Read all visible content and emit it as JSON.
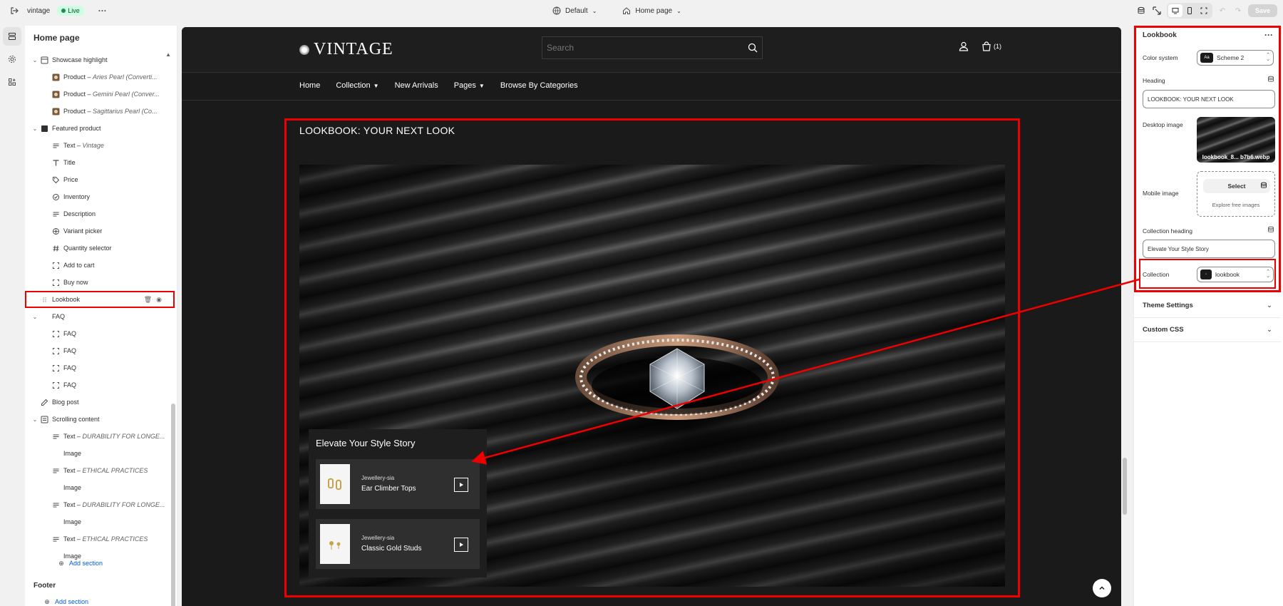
{
  "topbar": {
    "store_name": "vintage",
    "live_badge": "Live",
    "theme_select": "Default",
    "page_select": "Home page",
    "save_label": "Save"
  },
  "sidebar": {
    "title": "Home page",
    "items": [
      {
        "level": 0,
        "chev": "v",
        "icon": "grid-icon",
        "label": "Showcase highlight"
      },
      {
        "level": 1,
        "icon": "product-thumb",
        "label": "Product – ",
        "em": "Aries Pearl (Converti..."
      },
      {
        "level": 1,
        "icon": "product-thumb",
        "label": "Product – ",
        "em": "Gemini Pearl (Conver..."
      },
      {
        "level": 1,
        "icon": "product-thumb",
        "label": "Product – ",
        "em": "Sagittarius Pearl (Co..."
      },
      {
        "level": 0,
        "chev": "v",
        "icon": "featured-product-icon",
        "label": "Featured product"
      },
      {
        "level": 1,
        "icon": "text-lines-icon",
        "label": "Text – ",
        "em": "Vintage"
      },
      {
        "level": 1,
        "icon": "title-icon",
        "label": "Title"
      },
      {
        "level": 1,
        "icon": "price-tag-icon",
        "label": "Price"
      },
      {
        "level": 1,
        "icon": "inventory-icon",
        "label": "Inventory"
      },
      {
        "level": 1,
        "icon": "text-lines-icon",
        "label": "Description"
      },
      {
        "level": 1,
        "icon": "variant-icon",
        "label": "Variant picker"
      },
      {
        "level": 1,
        "icon": "hash-icon",
        "label": "Quantity selector"
      },
      {
        "level": 1,
        "icon": "bracket-icon",
        "label": "Add to cart"
      },
      {
        "level": 1,
        "icon": "bracket-icon",
        "label": "Buy now"
      },
      {
        "level": 0,
        "chev": "",
        "icon": "drag-handle-icon",
        "label": "Lookbook",
        "highlight": true
      },
      {
        "level": 0,
        "chev": "v",
        "icon": "",
        "label": "FAQ"
      },
      {
        "level": 1,
        "icon": "bracket-icon",
        "label": "FAQ"
      },
      {
        "level": 1,
        "icon": "bracket-icon",
        "label": "FAQ"
      },
      {
        "level": 1,
        "icon": "bracket-icon",
        "label": "FAQ"
      },
      {
        "level": 1,
        "icon": "bracket-icon",
        "label": "FAQ"
      },
      {
        "level": 0,
        "chev": "",
        "icon": "edit-icon",
        "label": "Blog post"
      },
      {
        "level": 0,
        "chev": "v",
        "icon": "scroll-content-icon",
        "label": "Scrolling content"
      },
      {
        "level": 1,
        "icon": "text-lines-icon",
        "label": "Text – ",
        "em": "DURABILITY FOR LONGE..."
      },
      {
        "level": 1,
        "icon": "",
        "label": "Image"
      },
      {
        "level": 1,
        "icon": "text-lines-icon",
        "label": "Text – ",
        "em": "ETHICAL PRACTICES"
      },
      {
        "level": 1,
        "icon": "",
        "label": "Image"
      },
      {
        "level": 1,
        "icon": "text-lines-icon",
        "label": "Text – ",
        "em": "DURABILITY FOR LONGE..."
      },
      {
        "level": 1,
        "icon": "",
        "label": "Image"
      },
      {
        "level": 1,
        "icon": "text-lines-icon",
        "label": "Text – ",
        "em": "ETHICAL PRACTICES"
      },
      {
        "level": 1,
        "icon": "",
        "label": "Image"
      }
    ],
    "add_section": "Add section",
    "footer_title": "Footer",
    "footer_add_section": "Add section"
  },
  "preview": {
    "logo": "VINTAGE",
    "search_placeholder": "Search",
    "cart_count": "(1)",
    "nav": [
      "Home",
      "Collection",
      "New Arrivals",
      "Pages",
      "Browse By Categories"
    ],
    "nav_dropdown": [
      false,
      true,
      false,
      true,
      false
    ],
    "section_heading": "LOOKBOOK: YOUR NEXT LOOK",
    "card_title": "Elevate Your Style Story",
    "products": [
      {
        "vendor": "Jewellery-sia",
        "name": "Ear Climber Tops"
      },
      {
        "vendor": "Jewellery-sia",
        "name": "Classic Gold Studs"
      }
    ]
  },
  "panel": {
    "title": "Lookbook",
    "color_system_label": "Color system",
    "color_scheme_swatch": "Aa",
    "color_scheme_value": "Scheme 2",
    "heading_label": "Heading",
    "heading_value": "LOOKBOOK: YOUR NEXT LOOK",
    "desktop_image_label": "Desktop image",
    "desktop_image_file": "lookbook_8... b7b6.webp",
    "mobile_image_label": "Mobile image",
    "select_label": "Select",
    "explore_label": "Explore free images",
    "collection_heading_label": "Collection heading",
    "collection_heading_value": "Elevate Your Style Story",
    "collection_label": "Collection",
    "collection_value": "lookbook",
    "theme_settings": "Theme Settings",
    "custom_css": "Custom CSS"
  },
  "colors": {
    "annotation_red": "#e00000",
    "live_bg": "#cdfee1",
    "link_blue": "#005bd3",
    "preview_bg": "#1a1a1a"
  }
}
